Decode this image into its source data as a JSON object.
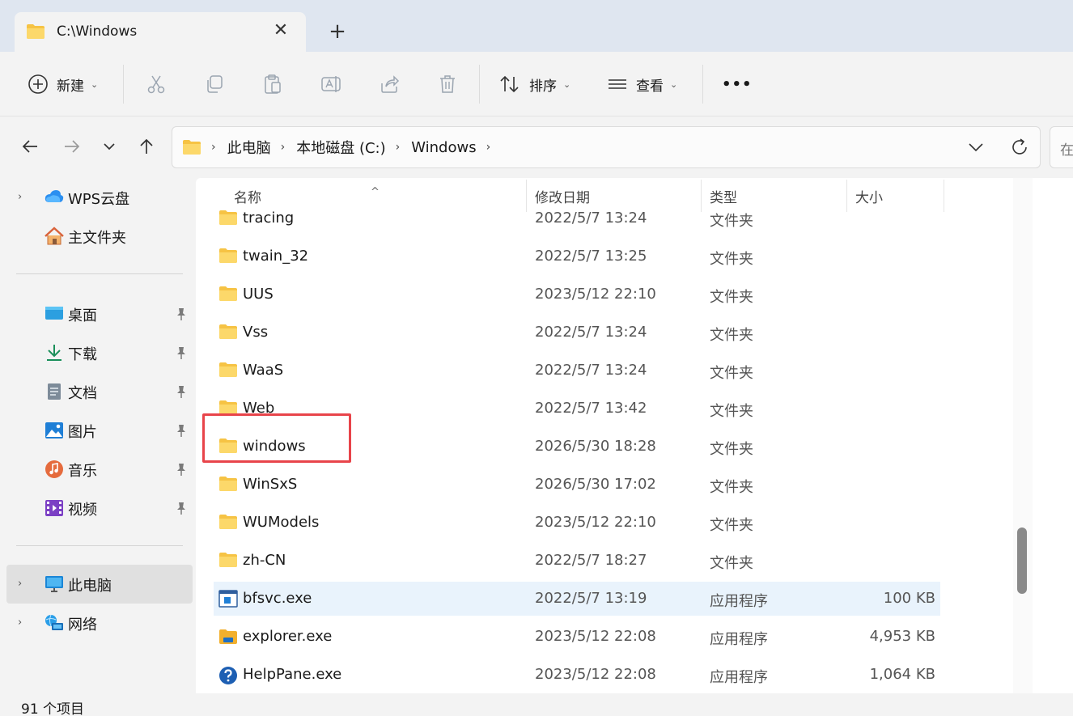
{
  "tab": {
    "title": "C:\\Windows",
    "close": "✕",
    "new": "+"
  },
  "toolbar": {
    "new_label": "新建",
    "sort_label": "排序",
    "view_label": "查看",
    "more": "•••",
    "chevron": "⌄"
  },
  "address": {
    "crumbs": [
      "此电脑",
      "本地磁盘 (C:)",
      "Windows"
    ],
    "sep": "›",
    "search_placeholder": "在"
  },
  "sidebar": {
    "items": [
      {
        "label": "WPS云盘",
        "icon": "cloud-icon"
      },
      {
        "label": "主文件夹",
        "icon": "home-icon"
      },
      {
        "label": "桌面",
        "icon": "desktop-icon"
      },
      {
        "label": "下载",
        "icon": "download-icon"
      },
      {
        "label": "文档",
        "icon": "document-icon"
      },
      {
        "label": "图片",
        "icon": "pictures-icon"
      },
      {
        "label": "音乐",
        "icon": "music-icon"
      },
      {
        "label": "视频",
        "icon": "video-icon"
      },
      {
        "label": "此电脑",
        "icon": "computer-icon"
      },
      {
        "label": "网络",
        "icon": "network-icon"
      }
    ],
    "expander": "›"
  },
  "columns": {
    "name": "名称",
    "date": "修改日期",
    "type": "类型",
    "size": "大小",
    "sort_indicator": "^"
  },
  "files": [
    {
      "name": "tracing",
      "date": "2022/5/7 13:24",
      "type": "文件夹",
      "size": "",
      "icon": "folder-icon"
    },
    {
      "name": "twain_32",
      "date": "2022/5/7 13:25",
      "type": "文件夹",
      "size": "",
      "icon": "folder-icon"
    },
    {
      "name": "UUS",
      "date": "2023/5/12 22:10",
      "type": "文件夹",
      "size": "",
      "icon": "folder-icon"
    },
    {
      "name": "Vss",
      "date": "2022/5/7 13:24",
      "type": "文件夹",
      "size": "",
      "icon": "folder-icon"
    },
    {
      "name": "WaaS",
      "date": "2022/5/7 13:24",
      "type": "文件夹",
      "size": "",
      "icon": "folder-icon"
    },
    {
      "name": "Web",
      "date": "2022/5/7 13:42",
      "type": "文件夹",
      "size": "",
      "icon": "folder-icon"
    },
    {
      "name": "windows",
      "date": "2026/5/30 18:28",
      "type": "文件夹",
      "size": "",
      "icon": "folder-icon"
    },
    {
      "name": "WinSxS",
      "date": "2026/5/30 17:02",
      "type": "文件夹",
      "size": "",
      "icon": "folder-icon"
    },
    {
      "name": "WUModels",
      "date": "2023/5/12 22:10",
      "type": "文件夹",
      "size": "",
      "icon": "folder-icon"
    },
    {
      "name": "zh-CN",
      "date": "2022/5/7 18:27",
      "type": "文件夹",
      "size": "",
      "icon": "folder-icon"
    },
    {
      "name": "bfsvc.exe",
      "date": "2022/5/7 13:19",
      "type": "应用程序",
      "size": "100 KB",
      "icon": "app-icon"
    },
    {
      "name": "explorer.exe",
      "date": "2023/5/12 22:08",
      "type": "应用程序",
      "size": "4,953 KB",
      "icon": "explorer-icon"
    },
    {
      "name": "HelpPane.exe",
      "date": "2023/5/12 22:08",
      "type": "应用程序",
      "size": "1,064 KB",
      "icon": "help-icon"
    }
  ],
  "status": {
    "count": "91 个项目"
  },
  "colors": {
    "accent": "#0067c0",
    "folder": "#f6c344",
    "highlight_box": "#e8444a",
    "selected_row": "#e9f3fc"
  }
}
